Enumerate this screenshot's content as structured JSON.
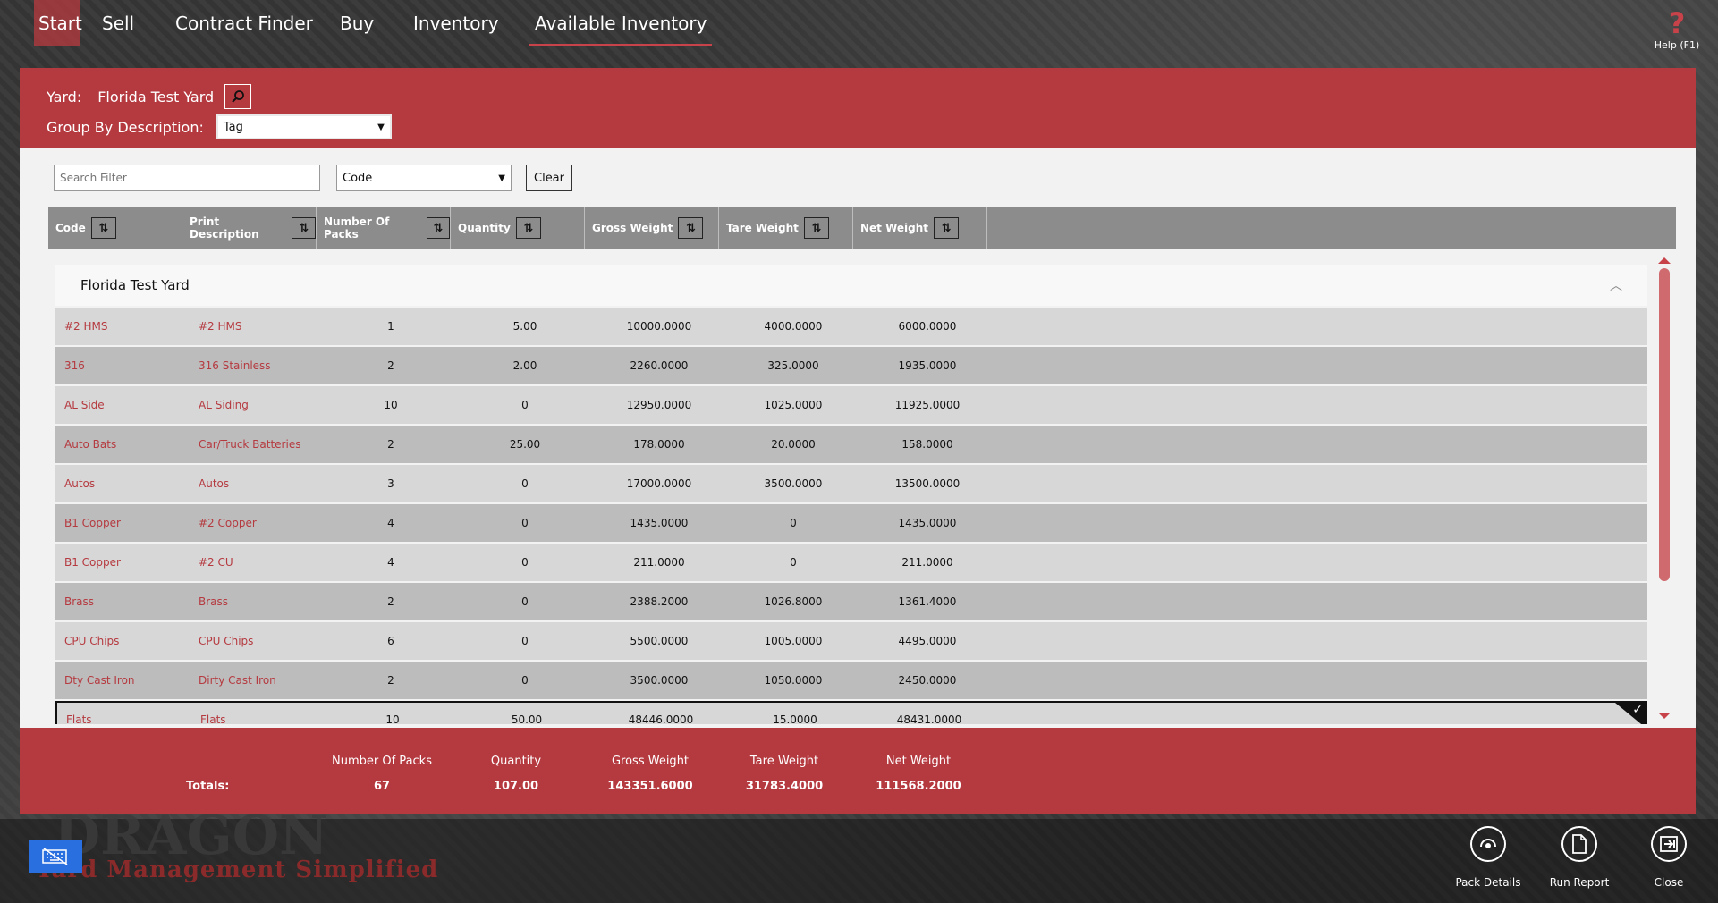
{
  "nav": {
    "items": [
      "Start",
      "Sell",
      "Contract Finder",
      "Buy",
      "Inventory",
      "Available Inventory"
    ],
    "active": "Available Inventory",
    "help_label": "Help (F1)",
    "help_glyph": "?"
  },
  "header": {
    "yard_label": "Yard:",
    "yard_value": "Florida Test Yard",
    "group_label": "Group By Description:",
    "group_value": "Tag"
  },
  "filter": {
    "search_placeholder": "Search Filter",
    "field_value": "Code",
    "clear_label": "Clear"
  },
  "columns": [
    "Code",
    "Print Description",
    "Number Of Packs",
    "Quantity",
    "Gross Weight",
    "Tare Weight",
    "Net Weight"
  ],
  "group": {
    "name": "Florida Test Yard"
  },
  "rows": [
    [
      "#2 HMS",
      "#2 HMS",
      "1",
      "5.00",
      "10000.0000",
      "4000.0000",
      "6000.0000"
    ],
    [
      "316",
      "316 Stainless",
      "2",
      "2.00",
      "2260.0000",
      "325.0000",
      "1935.0000"
    ],
    [
      "AL Side",
      "AL Siding",
      "10",
      "0",
      "12950.0000",
      "1025.0000",
      "11925.0000"
    ],
    [
      "Auto Bats",
      "Car/Truck Batteries",
      "2",
      "25.00",
      "178.0000",
      "20.0000",
      "158.0000"
    ],
    [
      "Autos",
      "Autos",
      "3",
      "0",
      "17000.0000",
      "3500.0000",
      "13500.0000"
    ],
    [
      "B1 Copper",
      "#2 Copper",
      "4",
      "0",
      "1435.0000",
      "0",
      "1435.0000"
    ],
    [
      "B1 Copper",
      "#2 CU",
      "4",
      "0",
      "211.0000",
      "0",
      "211.0000"
    ],
    [
      "Brass",
      "Brass",
      "2",
      "0",
      "2388.2000",
      "1026.8000",
      "1361.4000"
    ],
    [
      "CPU Chips",
      "CPU Chips",
      "6",
      "0",
      "5500.0000",
      "1005.0000",
      "4495.0000"
    ],
    [
      "Dty Cast Iron",
      "Dirty Cast Iron",
      "2",
      "0",
      "3500.0000",
      "1050.0000",
      "2450.0000"
    ],
    [
      "Flats",
      "Flats",
      "10",
      "50.00",
      "48446.0000",
      "15.0000",
      "48431.0000"
    ]
  ],
  "selected_row": 10,
  "totals": {
    "title": "Totals:",
    "labels": [
      "Number Of Packs",
      "Quantity",
      "Gross Weight",
      "Tare Weight",
      "Net Weight"
    ],
    "values": [
      "67",
      "107.00",
      "143351.6000",
      "31783.4000",
      "111568.2000"
    ]
  },
  "footer": {
    "buttons": [
      "Pack Details",
      "Run Report",
      "Close"
    ],
    "logo_tagline": "Yard Management Simplified",
    "logo_name": "DRAGON"
  },
  "colors": {
    "accent": "#b53a40",
    "keyboard": "#2a6fe0"
  }
}
